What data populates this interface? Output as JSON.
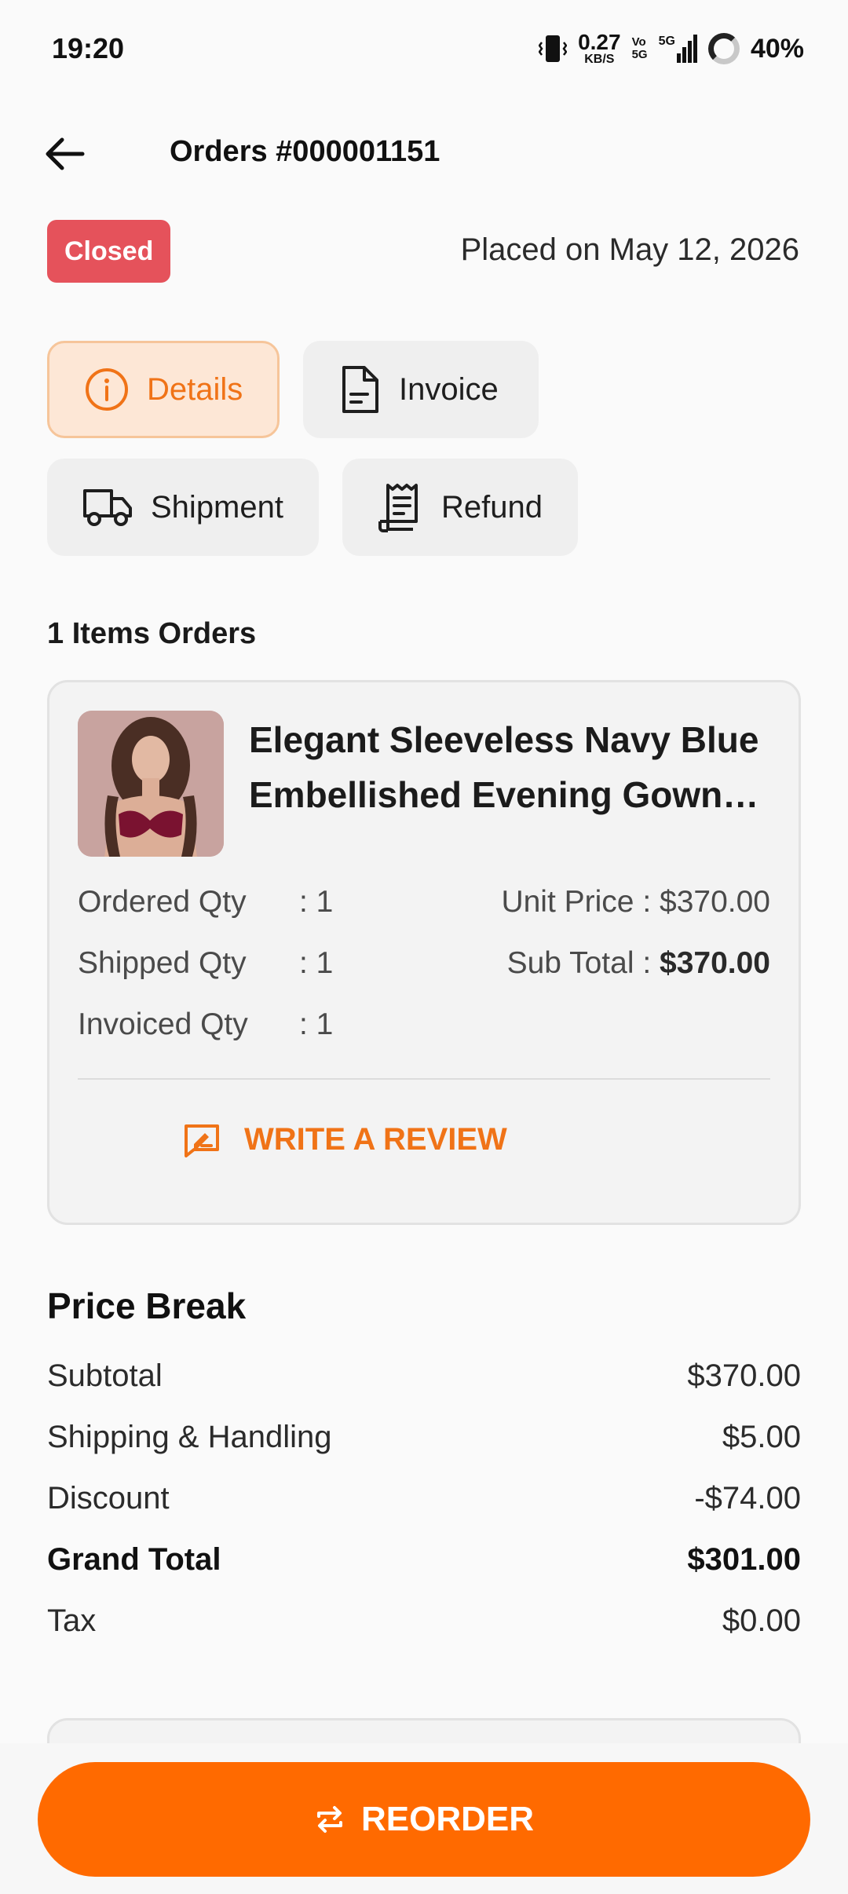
{
  "status_bar": {
    "time": "19:20",
    "net_speed_value": "0.27",
    "net_speed_unit": "KB/S",
    "volte_top": "Vo",
    "volte_bottom": "5G",
    "network_type": "5G",
    "battery": "40%",
    "icons": [
      "vibrate-icon",
      "signal-icon",
      "battery-ring-icon"
    ]
  },
  "header": {
    "title": "Orders #000001151",
    "back_icon": "back-arrow-icon"
  },
  "order": {
    "status": "Closed",
    "status_color": "#e5525b",
    "placed_on": "Placed on May 12, 2026"
  },
  "tabs": [
    {
      "label": "Details",
      "icon": "info-icon",
      "active": true
    },
    {
      "label": "Invoice",
      "icon": "document-icon",
      "active": false
    },
    {
      "label": "Shipment",
      "icon": "truck-icon",
      "active": false
    },
    {
      "label": "Refund",
      "icon": "receipt-icon",
      "active": false
    }
  ],
  "items_section": {
    "heading": "1 Items Orders",
    "items": [
      {
        "name": "Elegant Sleeveless Navy Blue Embellished Evening Gown with Sequin Details",
        "ordered_qty_label": "Ordered Qty",
        "ordered_qty_value": ": 1",
        "shipped_qty_label": "Shipped Qty",
        "shipped_qty_value": ": 1",
        "invoiced_qty_label": "Invoiced Qty",
        "invoiced_qty_value": ": 1",
        "unit_price_label": "Unit Price : ",
        "unit_price_value": "$370.00",
        "subtotal_label": "Sub Total : ",
        "subtotal_value": "$370.00",
        "review_label": "WRITE A REVIEW",
        "review_icon": "review-icon"
      }
    ]
  },
  "price_break": {
    "heading": "Price Break",
    "lines": [
      {
        "label": "Subtotal",
        "value": "$370.00",
        "bold": false
      },
      {
        "label": "Shipping & Handling",
        "value": "$5.00",
        "bold": false
      },
      {
        "label": "Discount",
        "value": "-$74.00",
        "bold": false
      },
      {
        "label": "Grand Total",
        "value": "$301.00",
        "bold": true
      },
      {
        "label": "Tax",
        "value": "$0.00",
        "bold": false
      }
    ]
  },
  "reorder": {
    "label": "REORDER",
    "icon": "repeat-icon",
    "color": "#ff6a00"
  },
  "accent_color": "#f07317"
}
